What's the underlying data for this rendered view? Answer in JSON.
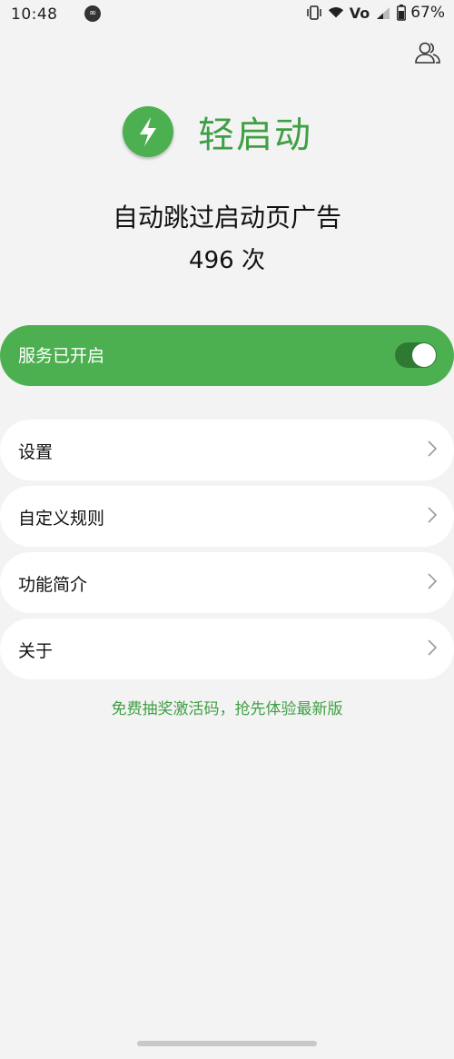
{
  "status_bar": {
    "time": "10:48",
    "app_icon": "infinity-icon",
    "net_label": "Vo",
    "battery": "67%"
  },
  "top_right_icon": "users-icon",
  "header": {
    "logo_icon": "lightning-icon",
    "title": "轻启动"
  },
  "stats": {
    "subtitle": "自动跳过启动页广告",
    "count_text": "496 次"
  },
  "service": {
    "label": "服务已开启",
    "enabled": true
  },
  "menu": [
    {
      "label": "设置"
    },
    {
      "label": "自定义规则"
    },
    {
      "label": "功能简介"
    },
    {
      "label": "关于"
    }
  ],
  "promo_text": "免费抽奖激活码，抢先体验最新版",
  "colors": {
    "accent": "#4cb050",
    "accent_text": "#3f9f44",
    "background": "#f3f3f3",
    "toggle_track": "#2f7a33"
  }
}
